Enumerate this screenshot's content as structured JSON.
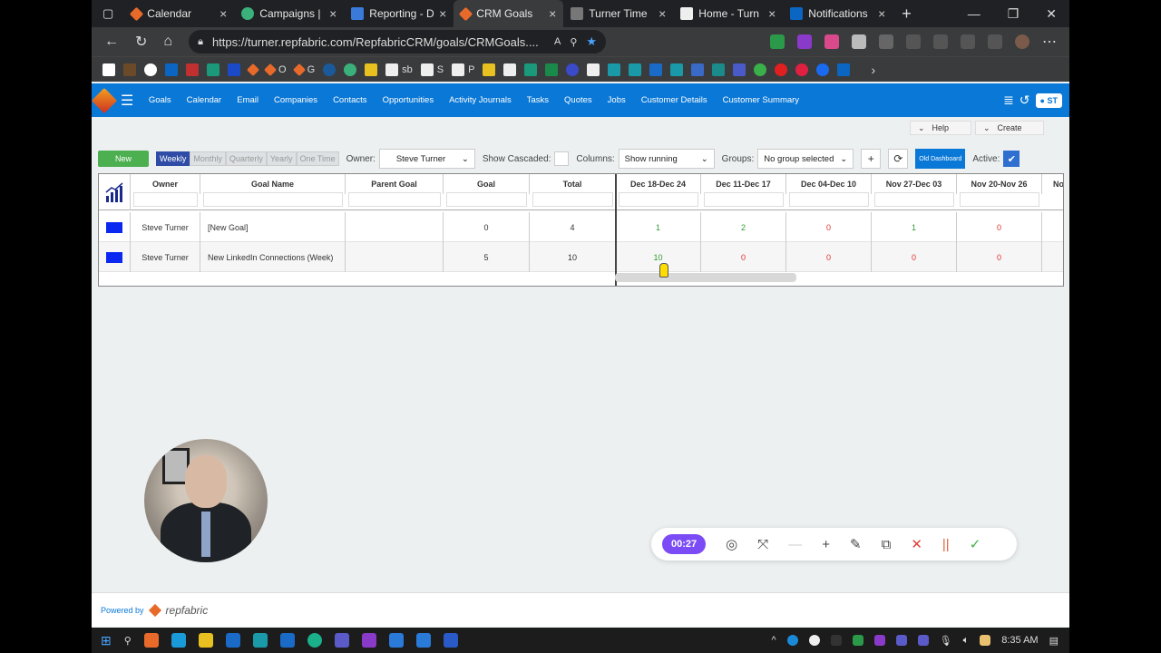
{
  "browser": {
    "tabs": [
      {
        "label": "Calendar",
        "color": "#e86a2a"
      },
      {
        "label": "Campaigns |",
        "color": "#3ab07a"
      },
      {
        "label": "Reporting - D",
        "color": "#3a7ad9"
      },
      {
        "label": "CRM Goals",
        "color": "#e86a2a",
        "active": true
      },
      {
        "label": "Turner Time",
        "color": "#888888"
      },
      {
        "label": "Home - Turn",
        "color": "#eeeeee"
      },
      {
        "label": "Notifications",
        "color": "#0a66c2"
      }
    ],
    "url": "https://turner.repfabric.com/RepfabricCRM/goals/CRMGoals....",
    "bookmarks": [
      "O",
      "G",
      "sb",
      "S",
      "P"
    ]
  },
  "appnav": {
    "items": [
      "Goals",
      "Calendar",
      "Email",
      "Companies",
      "Contacts",
      "Opportunities",
      "Activity Journals",
      "Tasks",
      "Quotes",
      "Jobs",
      "Customer Details",
      "Customer Summary"
    ],
    "user_initials": "ST"
  },
  "topbuttons": {
    "help": "Help",
    "create": "Create"
  },
  "toolbar": {
    "new_label": "New",
    "periods": [
      "Weekly",
      "Monthly",
      "Quarterly",
      "Yearly",
      "One Time"
    ],
    "selected_period": "Weekly",
    "owner_label": "Owner:",
    "owner_value": "Steve Turner",
    "cascaded_label": "Show Cascaded:",
    "columns_label": "Columns:",
    "columns_value": "Show running",
    "groups_label": "Groups:",
    "groups_value": "No group selected",
    "old_dashboard": "Old Dashboard",
    "active_label": "Active:"
  },
  "table": {
    "headers": [
      "Owner",
      "Goal Name",
      "Parent Goal",
      "Goal",
      "Total",
      "Dec 18-Dec 24",
      "Dec 11-Dec 17",
      "Dec 04-Dec 10",
      "Nov 27-Dec 03",
      "Nov 20-Nov 26",
      "No"
    ],
    "rows": [
      {
        "owner": "Steve Turner",
        "goal_name": "[New Goal]",
        "parent": "",
        "goal": "0",
        "total": "4",
        "weeks": [
          "1",
          "2",
          "0",
          "1",
          "0"
        ],
        "week_status": [
          "good",
          "good",
          "bad",
          "good",
          "bad"
        ]
      },
      {
        "owner": "Steve Turner",
        "goal_name": "New LinkedIn Connections (Week)",
        "parent": "",
        "goal": "5",
        "total": "10",
        "weeks": [
          "10",
          "0",
          "0",
          "0",
          "0"
        ],
        "week_status": [
          "good",
          "bad",
          "bad",
          "bad",
          "bad"
        ]
      }
    ]
  },
  "footer": {
    "powered": "Powered by",
    "brand": "repfabric"
  },
  "recorder": {
    "timer": "00:27"
  },
  "taskbar": {
    "time": "8:35 AM"
  }
}
